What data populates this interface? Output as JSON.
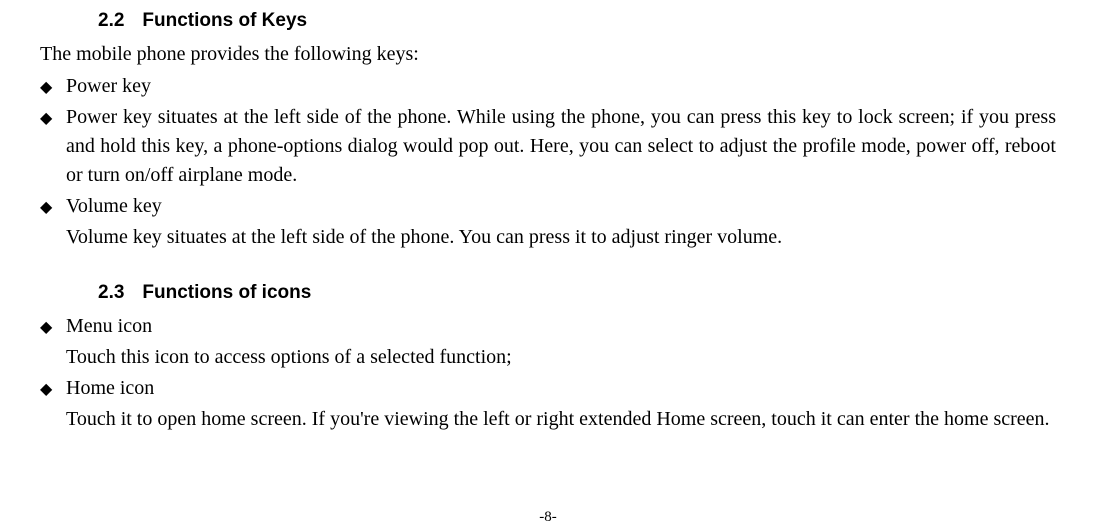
{
  "section1": {
    "number": "2.2",
    "title": "Functions of Keys",
    "intro": "The mobile phone provides the following keys:",
    "bullets": [
      {
        "title": "Power key",
        "desc": "Power key situates at the left side of the phone. While using the phone, you can press this key to lock screen; if you press and hold this key, a phone-options dialog would pop out. Here, you can select to adjust the profile mode, power off, reboot or turn on/off airplane mode."
      },
      {
        "title": "Volume key",
        "desc": "Volume key situates at the left side of the phone. You can press it to adjust ringer volume."
      }
    ]
  },
  "section2": {
    "number": "2.3",
    "title": "Functions of icons",
    "bullets": [
      {
        "title": "Menu icon",
        "desc": "Touch this icon to access options of a selected function;"
      },
      {
        "title": "Home icon",
        "desc": "Touch it to open home screen. If you're viewing the left or right extended Home screen, touch it can enter the home screen."
      }
    ]
  },
  "pageNumber": "-8-"
}
